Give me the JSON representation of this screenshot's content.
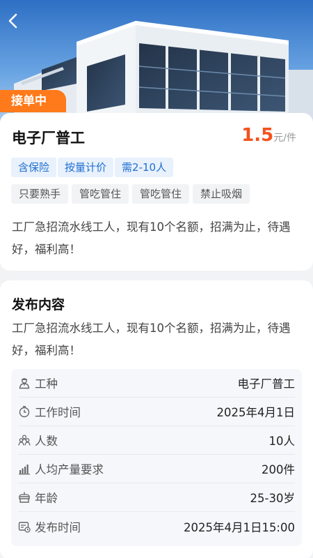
{
  "job": {
    "status_badge": "接单中",
    "title": "电子厂普工",
    "price_value": "1.5",
    "price_unit": "元/件",
    "feature_tags": [
      "含保险",
      "按量计价",
      "需2-10人"
    ],
    "benefit_tags": [
      "只要熟手",
      "管吃管住",
      "管吃管住",
      "禁止吸烟"
    ],
    "description": "工厂急招流水线工人，现有10个名额，招满为止，待遇好，福利高！"
  },
  "publish": {
    "section_title": "发布内容",
    "content": "工厂急招流水线工人，现有10个名额，招满为止，待遇好，福利高！",
    "details": [
      {
        "icon": "worker-icon",
        "label": "工种",
        "value": "电子厂普工"
      },
      {
        "icon": "stopwatch-icon",
        "label": "工作时间",
        "value": "2025年4月1日"
      },
      {
        "icon": "people-icon",
        "label": "人数",
        "value": "10人"
      },
      {
        "icon": "bar-chart-icon",
        "label": "人均产量要求",
        "value": "200件"
      },
      {
        "icon": "cake-icon",
        "label": "年龄",
        "value": "25-30岁"
      },
      {
        "icon": "calendar-clock-icon",
        "label": "发布时间",
        "value": "2025年4月1日15:00"
      }
    ]
  },
  "colors": {
    "accent_orange": "#ff7a1a",
    "price_red": "#f4511e",
    "tag_blue": "#1f6fd1"
  }
}
